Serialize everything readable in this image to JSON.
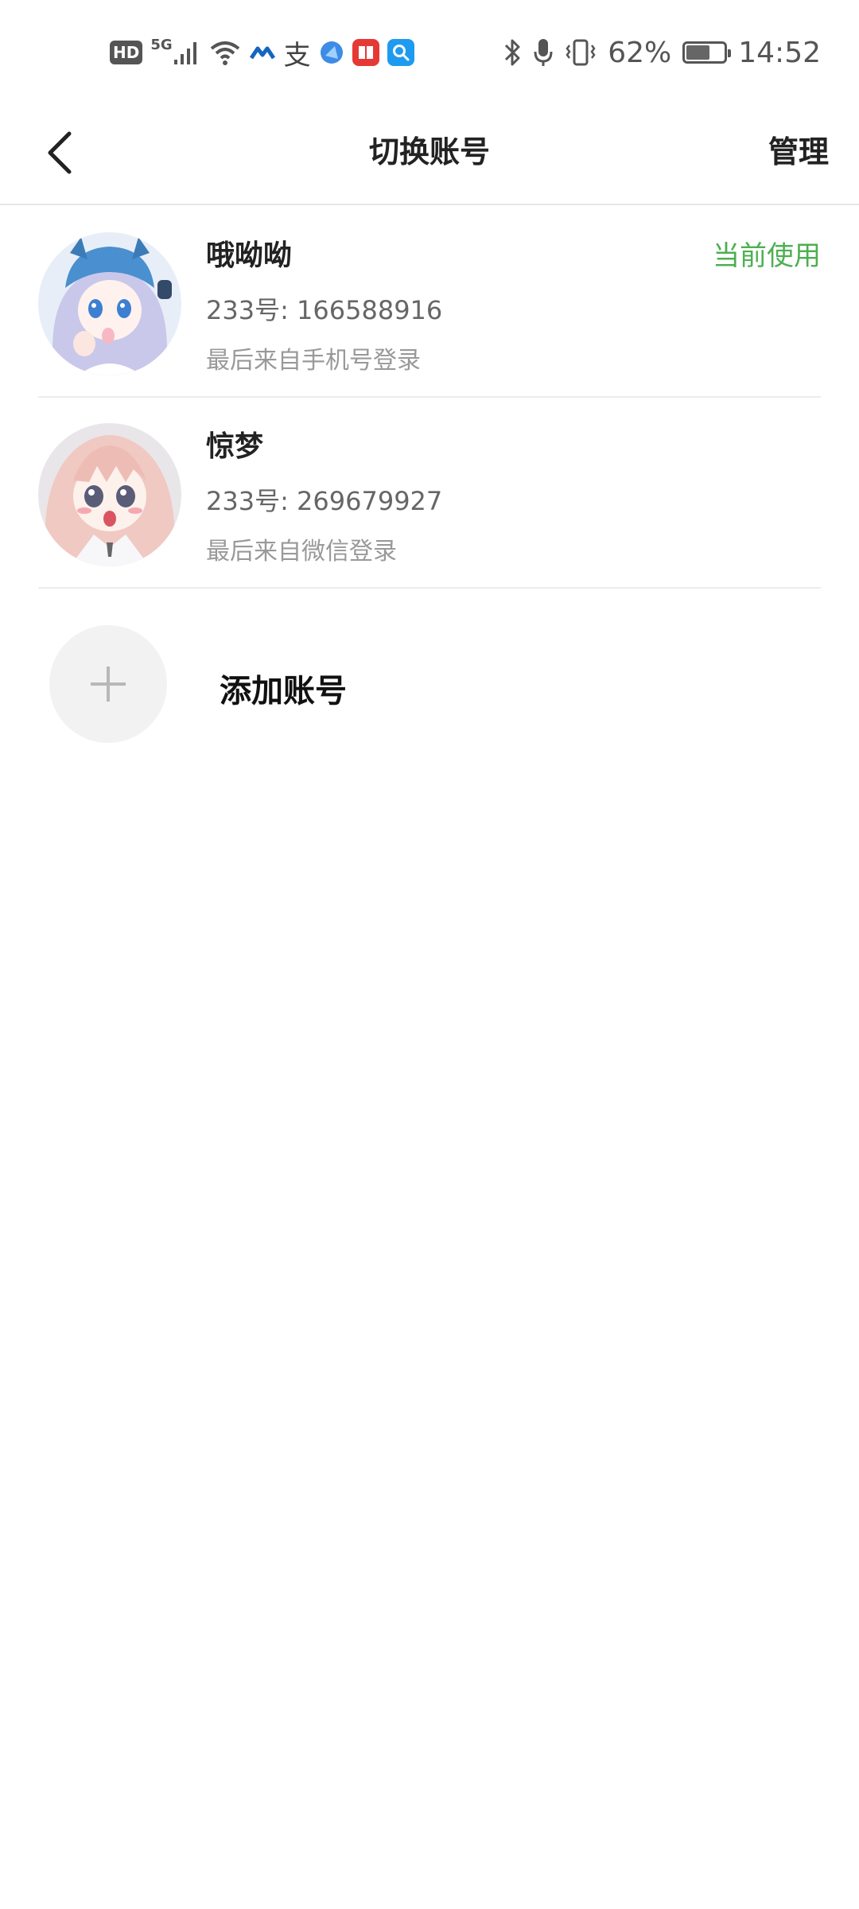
{
  "status_bar": {
    "left_icons": [
      "hd-icon",
      "5g-signal-icon",
      "wifi-icon",
      "app-blue-icon",
      "alipay-icon",
      "browser-icon",
      "book-app-icon",
      "search-app-icon"
    ],
    "hd_label": "HD",
    "network_label": "5G",
    "zhi_label": "支",
    "right_icons": [
      "bluetooth-icon",
      "microphone-icon",
      "vibrate-icon",
      "battery-icon"
    ],
    "battery_percent": "62%",
    "battery_level": 0.62,
    "time": "14:52"
  },
  "header": {
    "title": "切换账号",
    "manage_label": "管理"
  },
  "accounts": [
    {
      "name": "哦呦呦",
      "id_text": "233号: 166588916",
      "login_text": "最后来自手机号登录",
      "status": "当前使用"
    },
    {
      "name": "惊梦",
      "id_text": "233号: 269679927",
      "login_text": "最后来自微信登录",
      "status": ""
    }
  ],
  "add_account": {
    "label": "添加账号"
  },
  "colors": {
    "accent_green": "#4caf50",
    "divider": "#ececec",
    "add_circle_bg": "#f2f2f2"
  }
}
